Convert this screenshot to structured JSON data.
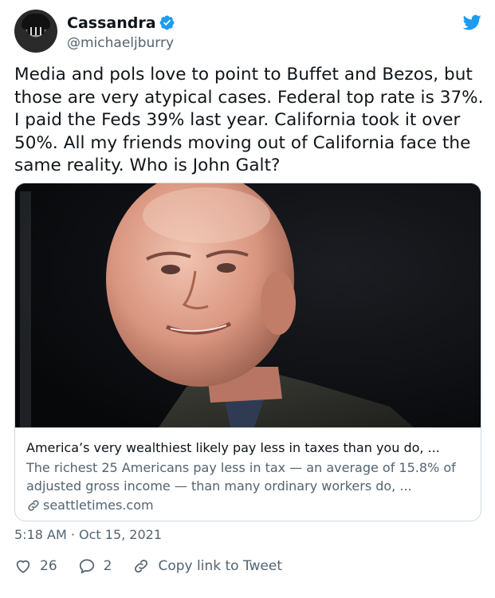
{
  "user": {
    "name": "Cassandra",
    "handle": "@michaeljburry",
    "verified": true
  },
  "tweet": {
    "text": "Media and pols love to point to Buffet and Bezos, but those are very atypical cases. Federal top rate is 37%. I paid the Feds 39% last year. California took it over 50%. All my friends moving out of California face the same reality. Who is John Galt?",
    "timestamp": "5:18 AM · Oct 15, 2021"
  },
  "card": {
    "title": "America’s very wealthiest likely pay less in taxes than you do, ...",
    "description": "The richest 25 Americans pay less in tax — an average of 15.8% of adjusted gross income — than many ordinary workers do, ...",
    "domain": "seattletimes.com",
    "image": "photo-of-bald-man-smiling"
  },
  "actions": {
    "likes": "26",
    "replies": "2",
    "copy_link_label": "Copy link to Tweet"
  },
  "icons": {
    "verified": "verified-badge-icon",
    "twitter": "twitter-bird-icon",
    "like": "heart-icon",
    "reply": "reply-bubble-icon",
    "link": "link-icon"
  },
  "colors": {
    "brand_blue": "#1d9bf0",
    "text_primary": "#0f1419",
    "text_secondary": "#536471",
    "border": "#cfd9de"
  }
}
